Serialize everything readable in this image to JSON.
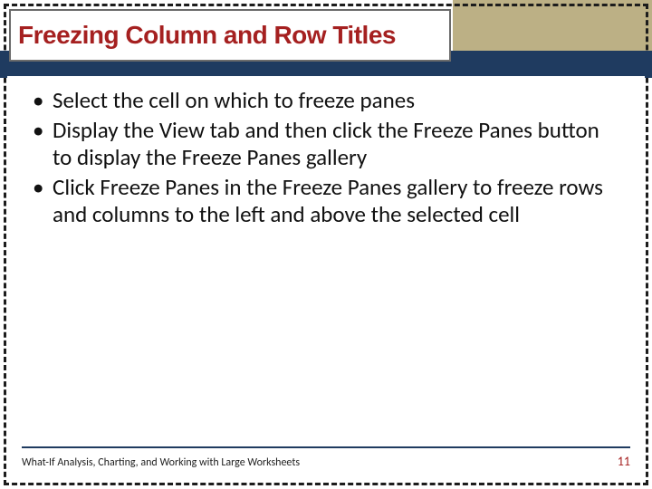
{
  "title": "Freezing Column and Row Titles",
  "bullets": [
    "Select the cell on which to freeze panes",
    "Display the View tab and then click the Freeze Panes button to display the Freeze Panes gallery",
    "Click Freeze Panes in the Freeze Panes gallery to freeze rows and columns to the left and above the selected cell"
  ],
  "footer": {
    "left": "What-If Analysis, Charting, and Working with Large Worksheets",
    "page": "11"
  },
  "colors": {
    "accent_red": "#A52020",
    "navy": "#1F3B60",
    "tan": "#BCB085"
  }
}
